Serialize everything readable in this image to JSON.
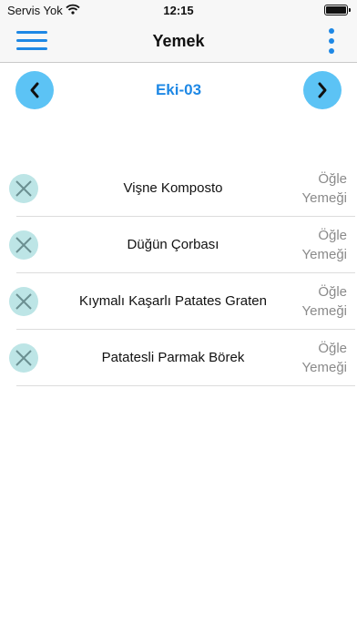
{
  "status_bar": {
    "carrier": "Servis Yok",
    "time": "12:15",
    "wifi_icon": "wifi-icon",
    "battery_icon": "battery-icon"
  },
  "nav": {
    "title": "Yemek",
    "menu_icon": "hamburger-menu-icon",
    "more_icon": "vertical-ellipsis-icon",
    "accent_color": "#1e88e5"
  },
  "date_nav": {
    "date": "Eki-03",
    "prev_icon": "chevron-left-icon",
    "next_icon": "chevron-right-icon",
    "button_color": "#5cc3f5"
  },
  "items": [
    {
      "name": "Vişne Komposto",
      "meal_line1": "Öğle",
      "meal_line2": "Yemeği"
    },
    {
      "name": "Düğün Çorbası",
      "meal_line1": "Öğle",
      "meal_line2": "Yemeği"
    },
    {
      "name": "Kıymalı Kaşarlı Patates Graten",
      "meal_line1": "Öğle",
      "meal_line2": "Yemeği"
    },
    {
      "name": "Patatesli Parmak Börek",
      "meal_line1": "Öğle",
      "meal_line2": "Yemeği"
    }
  ]
}
